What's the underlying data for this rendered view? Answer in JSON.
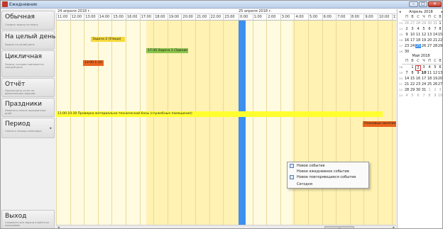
{
  "window": {
    "title": "Ежедневник",
    "close": "✕",
    "min": "–",
    "max": "□"
  },
  "sidebar": {
    "nav": [
      {
        "title": "Обычная",
        "desc": "Создать задачу по плану"
      },
      {
        "title": "На целый день",
        "desc": "Задача на целый день"
      },
      {
        "title": "Цикличная",
        "desc": "Задача, которая повторяется каждый день"
      },
      {
        "title": "Отчёт",
        "desc": "Просмотреть отчёт по выполненным задачам"
      },
      {
        "title": "Праздники",
        "desc": "Изменить список праздничных дней"
      },
      {
        "title": "Период",
        "desc": "Сменить период календаря",
        "arrow": "▸"
      },
      {
        "title": "Выход",
        "desc": "Сохранить все задачи и выйти из программы"
      }
    ]
  },
  "timeline": {
    "dates": [
      "24 апреля 2018 г.",
      "25 апреля 2018 г."
    ],
    "hours_day1": [
      "11:00",
      "12:00",
      "13:00",
      "14:00",
      "15:00",
      "16:00",
      "17:00",
      "18:00",
      "19:00",
      "20:00",
      "21:00",
      "22:00",
      "23:00"
    ],
    "hours_day2": [
      "0:00",
      "1:00",
      "2:00",
      "3:00",
      "4:00",
      "5:00",
      "6:00",
      "7:00",
      "8:00",
      "9:00",
      "10:00",
      "11:"
    ],
    "events": [
      {
        "text": "Задача 2 (Улица)",
        "color": "#f5d93a"
      },
      {
        "text": "17:30 Задача 1 (Здание",
        "color": "#8bc34a"
      },
      {
        "text": "13:00 1 (2)",
        "color": "#e8641e"
      },
      {
        "text": "11:00 10:30 Проверка материально-технической базы (служебные помещения)",
        "color": "#ffff30"
      },
      {
        "text": "Плановые занятия",
        "color": "#e8641e"
      }
    ]
  },
  "context_menu": {
    "items": [
      "Новое событие",
      "Новое ежедневное событие",
      "Новое повторяющееся событие",
      "Сегодня"
    ]
  },
  "scroll": {
    "grip": "≡",
    "left": "◂",
    "right": "▸"
  },
  "calendar": {
    "dow": [
      "П",
      "В",
      "С",
      "Ч",
      "П",
      "С",
      "В"
    ],
    "months": [
      {
        "title": "Апрель 2018",
        "prev": "◂",
        "next": "▸",
        "weeks": [
          {
            "wk": "13",
            "days": [
              "26",
              "27",
              "28",
              "29",
              "30",
              "31",
              "1"
            ]
          },
          {
            "wk": "14",
            "days": [
              "2",
              "3",
              "4",
              "5",
              "6",
              "7",
              "8"
            ]
          },
          {
            "wk": "15",
            "days": [
              "9",
              "10",
              "11",
              "12",
              "13",
              "14",
              "15"
            ]
          },
          {
            "wk": "16",
            "days": [
              "16",
              "17",
              "18",
              "19",
              "20",
              "21",
              "22"
            ]
          },
          {
            "wk": "17",
            "days": [
              "23",
              "24",
              "25",
              "26",
              "27",
              "28",
              "29"
            ]
          },
          {
            "wk": "18",
            "days": [
              "30",
              "",
              "",
              "",
              "",
              "",
              ""
            ]
          }
        ]
      },
      {
        "title": "Май 2018",
        "weeks": [
          {
            "wk": "18",
            "days": [
              "",
              "1",
              "2",
              "3",
              "4",
              "5",
              "6"
            ]
          },
          {
            "wk": "19",
            "days": [
              "7",
              "8",
              "9",
              "10",
              "11",
              "12",
              "13"
            ]
          },
          {
            "wk": "20",
            "days": [
              "14",
              "15",
              "16",
              "17",
              "18",
              "19",
              "20"
            ]
          },
          {
            "wk": "21",
            "days": [
              "21",
              "22",
              "23",
              "24",
              "25",
              "26",
              "27"
            ]
          },
          {
            "wk": "22",
            "days": [
              "28",
              "29",
              "30",
              "31",
              "1",
              "2",
              "3"
            ]
          },
          {
            "wk": "23",
            "days": [
              "4",
              "5",
              "6",
              "7",
              "8",
              "9",
              "10"
            ]
          }
        ]
      }
    ]
  }
}
